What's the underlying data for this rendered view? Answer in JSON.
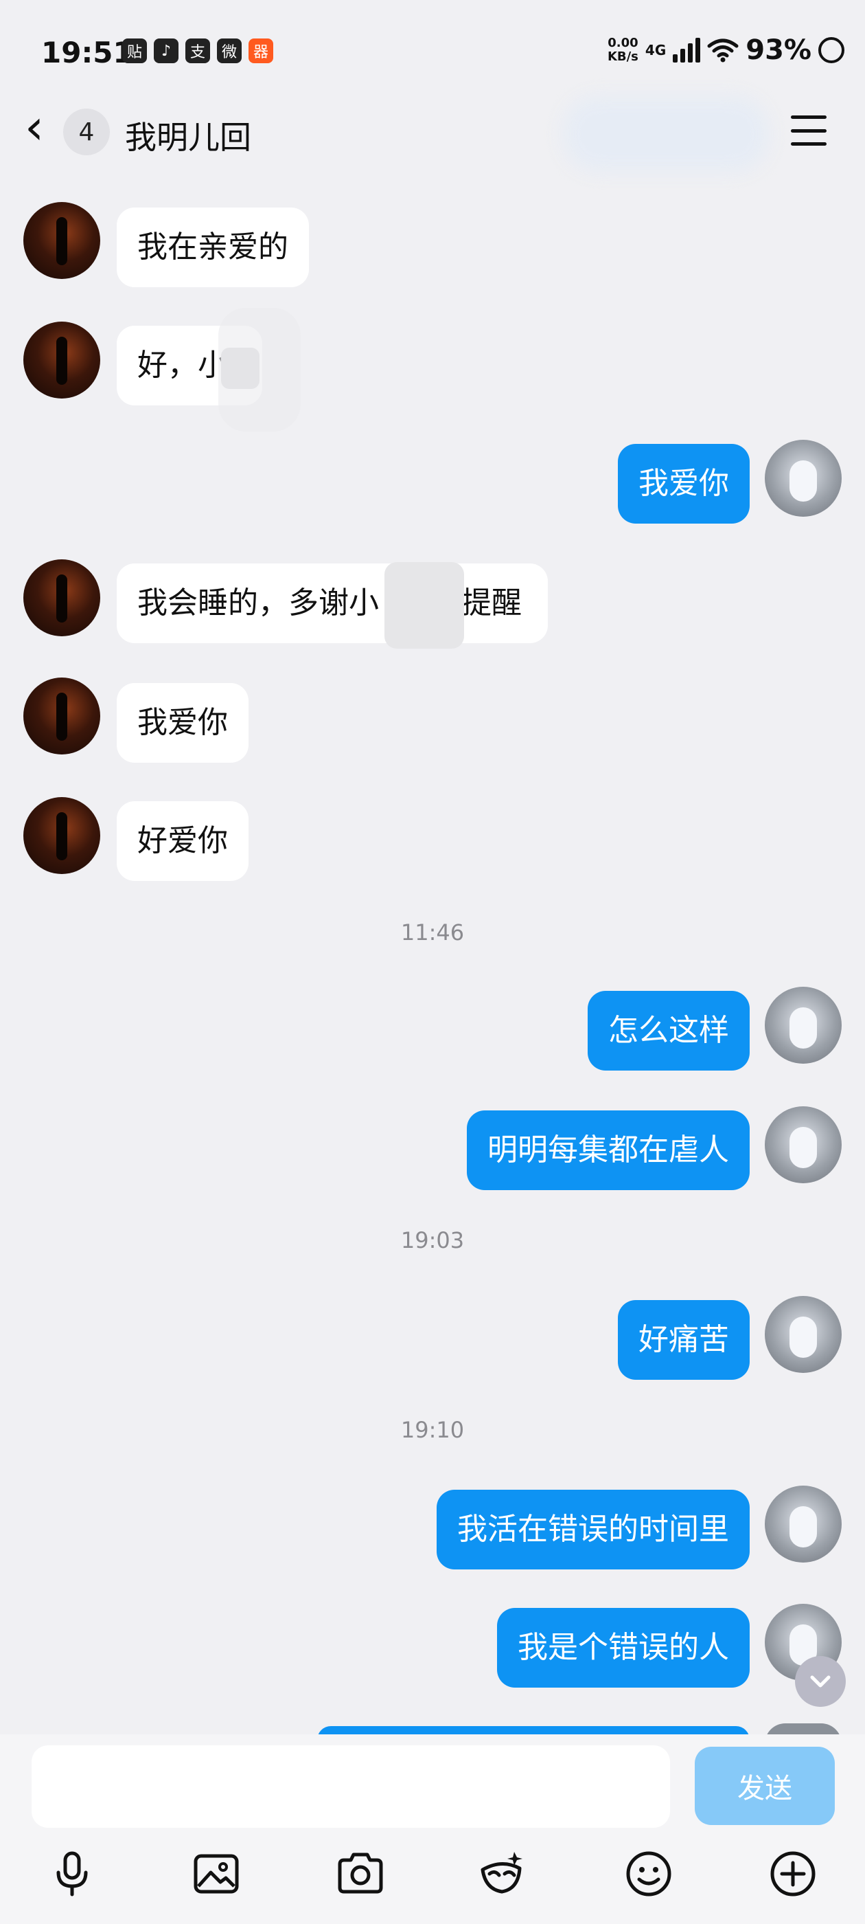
{
  "status_bar": {
    "time": "19:51",
    "app_icons": [
      "贴",
      "♪",
      "支",
      "微",
      "器"
    ],
    "net_speed_value": "0.00",
    "net_speed_unit": "KB/s",
    "network": "4G",
    "battery": "93%"
  },
  "header": {
    "unread_count": "4",
    "title": "我明儿回"
  },
  "messages": [
    {
      "side": "left",
      "text": "我在亲爱的"
    },
    {
      "side": "left",
      "text": "好，小"
    },
    {
      "side": "right",
      "text": "我爱你"
    },
    {
      "side": "left",
      "text_a": "我会睡的，多谢小",
      "text_b": "提醒"
    },
    {
      "side": "left",
      "text": "我爱你"
    },
    {
      "side": "left",
      "text": "好爱你"
    },
    {
      "type": "timestamp",
      "text": "11:46"
    },
    {
      "side": "right",
      "text": "怎么这样"
    },
    {
      "side": "right",
      "text": "明明每集都在虐人"
    },
    {
      "type": "timestamp",
      "text": "19:03"
    },
    {
      "side": "right",
      "text": "好痛苦"
    },
    {
      "type": "timestamp",
      "text": "19:10"
    },
    {
      "side": "right",
      "text": "我活在错误的时间里"
    },
    {
      "side": "right",
      "text": "我是个错误的人"
    }
  ],
  "composer": {
    "input_value": "",
    "send_label": "发送"
  },
  "toolbar_icons": [
    "microphone-icon",
    "image-icon",
    "camera-icon",
    "sticker-icon",
    "emoji-icon",
    "plus-icon"
  ],
  "colors": {
    "accent": "#0e93f3",
    "send_disabled": "#86c9f8",
    "background": "#f0f0f3"
  }
}
